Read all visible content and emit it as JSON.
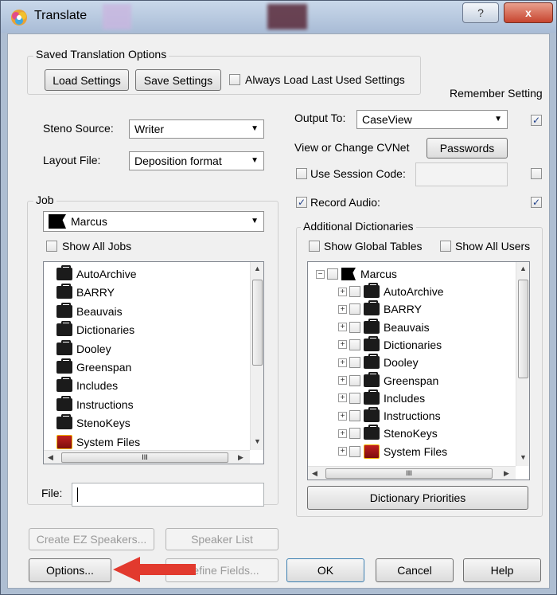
{
  "window": {
    "title": "Translate",
    "help_button": "?",
    "close_button": "x"
  },
  "saved_options": {
    "group_title": "Saved Translation Options",
    "load_label": "Load Settings",
    "save_label": "Save Settings",
    "always_load_label": "Always Load Last Used Settings"
  },
  "remember_setting_label": "Remember Setting",
  "steno_source": {
    "label": "Steno Source:",
    "value": "Writer"
  },
  "layout_file": {
    "label": "Layout File:",
    "value": "Deposition format"
  },
  "output_to": {
    "label": "Output To:",
    "value": "CaseView",
    "remember_checked": true
  },
  "cvnet": {
    "label": "View or Change CVNet",
    "passwords_label": "Passwords"
  },
  "session_code": {
    "label": "Use Session Code:",
    "value": "",
    "checked": false,
    "remember_checked": false
  },
  "record_audio": {
    "label": "Record Audio:",
    "checked": true,
    "remember_checked": true
  },
  "job": {
    "group_title": "Job",
    "selected": "Marcus",
    "show_all_label": "Show All Jobs",
    "items": [
      {
        "label": "AutoArchive",
        "icon": "briefcase-icon"
      },
      {
        "label": "BARRY",
        "icon": "briefcase-icon"
      },
      {
        "label": "Beauvais",
        "icon": "briefcase-icon"
      },
      {
        "label": "Dictionaries",
        "icon": "briefcase-icon"
      },
      {
        "label": "Dooley",
        "icon": "briefcase-icon"
      },
      {
        "label": "Greenspan",
        "icon": "briefcase-icon"
      },
      {
        "label": "Includes",
        "icon": "briefcase-icon"
      },
      {
        "label": "Instructions",
        "icon": "briefcase-icon"
      },
      {
        "label": "StenoKeys",
        "icon": "briefcase-icon"
      },
      {
        "label": "System Files",
        "icon": "system-files-icon"
      }
    ],
    "file_label": "File:",
    "file_value": ""
  },
  "dictionaries": {
    "group_title": "Additional Dictionaries",
    "show_global_label": "Show Global Tables",
    "show_all_users_label": "Show All Users",
    "root": "Marcus",
    "items": [
      "AutoArchive",
      "BARRY",
      "Beauvais",
      "Dictionaries",
      "Dooley",
      "Greenspan",
      "Includes",
      "Instructions",
      "StenoKeys",
      "System Files"
    ],
    "priorities_label": "Dictionary Priorities"
  },
  "bottom": {
    "create_ez_label": "Create EZ Speakers...",
    "speaker_list_label": "Speaker List",
    "options_label": "Options...",
    "define_fields_label": "Define Fields...",
    "ok_label": "OK",
    "cancel_label": "Cancel",
    "help_label": "Help"
  },
  "scrollbar_grip": "III",
  "arrow_color": "#e23a2e"
}
